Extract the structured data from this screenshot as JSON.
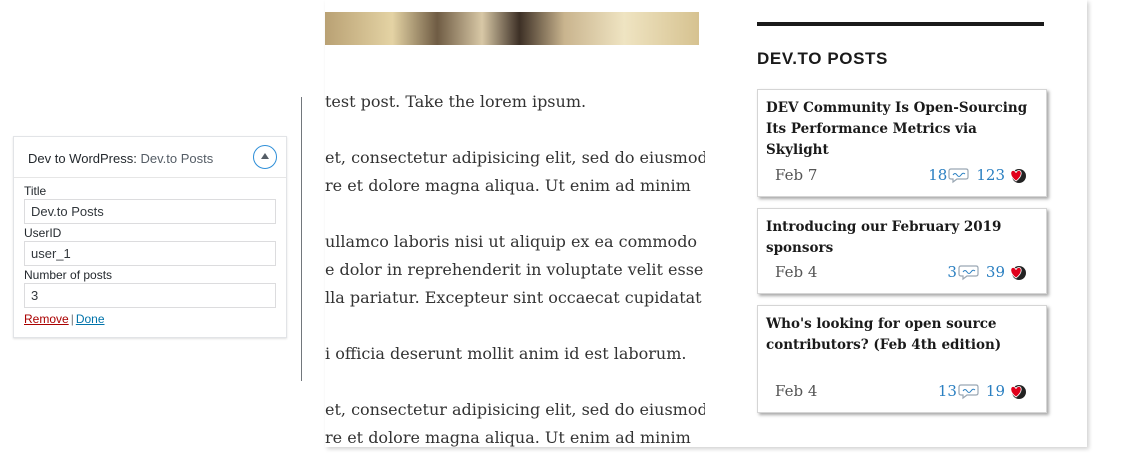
{
  "widget": {
    "title_prefix": "Dev to WordPress:",
    "title_name": "Dev.to Posts",
    "fields": {
      "title": {
        "label": "Title",
        "value": "Dev.to Posts"
      },
      "userid": {
        "label": "UserID",
        "value": "user_1"
      },
      "posts": {
        "label": "Number of posts",
        "value": "3"
      }
    },
    "actions": {
      "remove": "Remove",
      "separator": "|",
      "done": "Done"
    }
  },
  "post": {
    "lines": [
      "test post. Take the lorem ipsum.",
      "et, consectetur adipisicing elit, sed do eiusmod",
      "re et dolore magna aliqua. Ut enim ad minim",
      "ullamco laboris nisi ut aliquip ex ea commodo",
      "e dolor in reprehenderit in voluptate velit esse",
      "lla pariatur. Excepteur sint occaecat cupidatat",
      "i officia deserunt mollit anim id est laborum.",
      "et, consectetur adipisicing elit, sed do eiusmod",
      "re et dolore magna aliqua. Ut enim ad minim"
    ]
  },
  "sidebar": {
    "widget_title": "DEV.TO POSTS",
    "posts": [
      {
        "title": "DEV Community Is Open-Sourcing Its Performance Metrics via Skylight",
        "date": "Feb 7",
        "comments": "18",
        "reactions": "123"
      },
      {
        "title": "Introducing our February 2019 sponsors",
        "date": "Feb 4",
        "comments": "3",
        "reactions": "39"
      },
      {
        "title": "Who's looking for open source contributors? (Feb 4th edition)",
        "date": "Feb 4",
        "comments": "13",
        "reactions": "19"
      }
    ]
  },
  "colors": {
    "accent": "#2f8fd8",
    "link": "#2a7fc1",
    "remove": "#aa0000",
    "heart": "#e0001b"
  }
}
